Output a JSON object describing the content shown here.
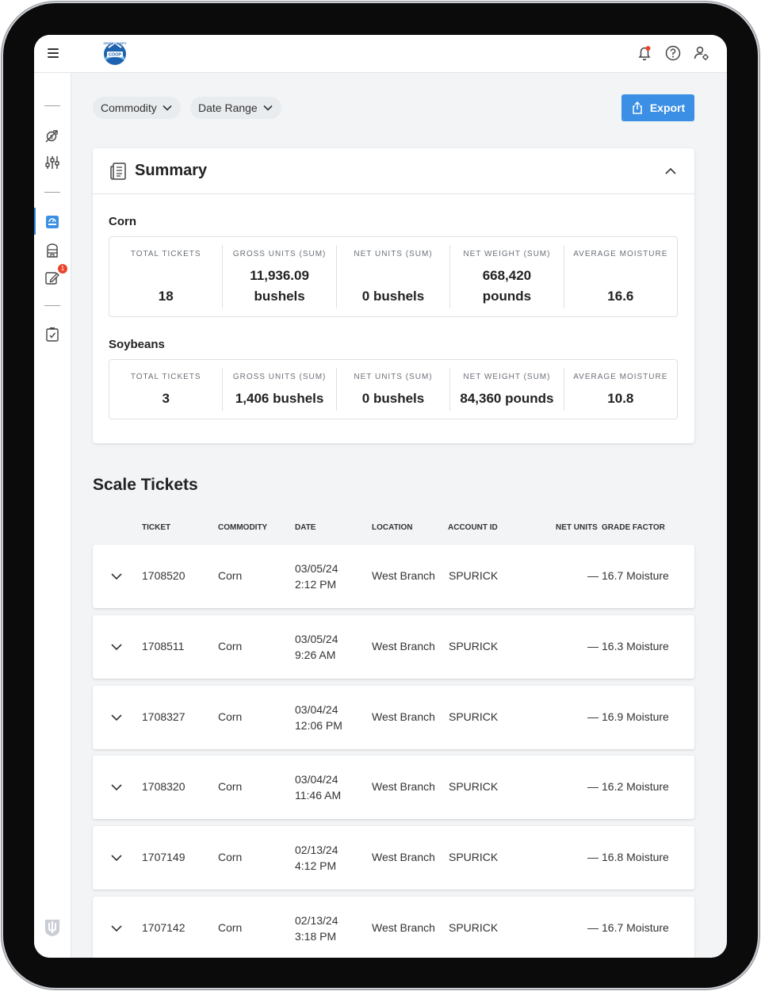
{
  "header": {
    "logo_text": [
      "CROSS COUNTY",
      "COOP"
    ]
  },
  "filters": {
    "commodity_label": "Commodity",
    "date_range_label": "Date Range",
    "export_label": "Export"
  },
  "summary": {
    "title": "Summary",
    "groups": [
      {
        "name": "Corn",
        "stats": [
          {
            "label": "TOTAL TICKETS",
            "value": "18"
          },
          {
            "label": "GROSS UNITS (SUM)",
            "value_line1": "11,936.09",
            "value_line2": "bushels"
          },
          {
            "label": "NET UNITS (SUM)",
            "value": "0 bushels"
          },
          {
            "label": "NET WEIGHT (SUM)",
            "value_line1": "668,420",
            "value_line2": "pounds"
          },
          {
            "label": "AVERAGE MOISTURE",
            "value": "16.6"
          }
        ]
      },
      {
        "name": "Soybeans",
        "stats": [
          {
            "label": "TOTAL TICKETS",
            "value": "3"
          },
          {
            "label": "GROSS UNITS (SUM)",
            "value": "1,406 bushels"
          },
          {
            "label": "NET UNITS (SUM)",
            "value": "0 bushels"
          },
          {
            "label": "NET WEIGHT (SUM)",
            "value": "84,360 pounds"
          },
          {
            "label": "AVERAGE MOISTURE",
            "value": "10.8"
          }
        ]
      }
    ]
  },
  "tickets": {
    "title": "Scale Tickets",
    "columns": [
      "TICKET",
      "COMMODITY",
      "DATE",
      "LOCATION",
      "ACCOUNT ID",
      "NET UNITS",
      "GRADE FACTOR"
    ],
    "rows": [
      {
        "ticket": "1708520",
        "commodity": "Corn",
        "date": "03/05/24",
        "time": "2:12 PM",
        "location": "West Branch",
        "account": "SPURICK",
        "net_units": "—",
        "grade": "16.7 Moisture"
      },
      {
        "ticket": "1708511",
        "commodity": "Corn",
        "date": "03/05/24",
        "time": "9:26 AM",
        "location": "West Branch",
        "account": "SPURICK",
        "net_units": "—",
        "grade": "16.3 Moisture"
      },
      {
        "ticket": "1708327",
        "commodity": "Corn",
        "date": "03/04/24",
        "time": "12:06 PM",
        "location": "West Branch",
        "account": "SPURICK",
        "net_units": "—",
        "grade": "16.9 Moisture"
      },
      {
        "ticket": "1708320",
        "commodity": "Corn",
        "date": "03/04/24",
        "time": "11:46 AM",
        "location": "West Branch",
        "account": "SPURICK",
        "net_units": "—",
        "grade": "16.2 Moisture"
      },
      {
        "ticket": "1707149",
        "commodity": "Corn",
        "date": "02/13/24",
        "time": "4:12 PM",
        "location": "West Branch",
        "account": "SPURICK",
        "net_units": "—",
        "grade": "16.8 Moisture"
      },
      {
        "ticket": "1707142",
        "commodity": "Corn",
        "date": "02/13/24",
        "time": "3:18 PM",
        "location": "West Branch",
        "account": "SPURICK",
        "net_units": "—",
        "grade": "16.7 Moisture"
      }
    ]
  },
  "sidebar": {
    "items": [
      {
        "icon": "dollar-chart-icon"
      },
      {
        "icon": "sliders-icon"
      },
      {
        "icon": "scale-icon",
        "active": true
      },
      {
        "icon": "silo-icon"
      },
      {
        "icon": "edit-note-icon",
        "badge": "1"
      },
      {
        "icon": "checklist-icon"
      }
    ],
    "footer_icon": "brand-shield-icon"
  },
  "notifications": {
    "has_alert": true
  },
  "colors": {
    "accent": "#3b8fe5",
    "alert": "#e8452c",
    "background": "#f2f4f6"
  }
}
